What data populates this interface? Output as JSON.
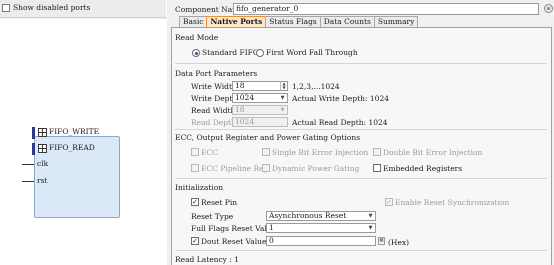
{
  "left": {
    "show_disabled_label": "Show disabled ports",
    "ports": [
      "FIFO_WRITE",
      "FIFO_READ",
      "clk",
      "rst"
    ]
  },
  "header": {
    "component_name_label": "Component Name",
    "component_name_value": "fifo_generator_0"
  },
  "tabs": [
    "Basic",
    "Native Ports",
    "Status Flags",
    "Data Counts",
    "Summary"
  ],
  "read_mode": {
    "title": "Read Mode",
    "opt1": "Standard FIFO",
    "opt2": "First Word Fall Through"
  },
  "data_port": {
    "title": "Data Port Parameters",
    "write_width_label": "Write Width",
    "write_width_value": "18",
    "write_width_range": "1,2,3,...1024",
    "write_depth_label": "Write Depth",
    "write_depth_value": "1024",
    "actual_write_depth": "Actual Write Depth:  1024",
    "read_width_label": "Read Width",
    "read_width_value": "18",
    "read_depth_label": "Read Depth",
    "read_depth_value": "1024",
    "actual_read_depth": "Actual Read Depth:   1024"
  },
  "ecc": {
    "title": "ECC, Output Register and Power Gating Options",
    "ecc_label": "ECC",
    "single_bit": "Single Bit Error Injection",
    "double_bit": "Double Bit Error Injection",
    "pipeline_reg": "ECC Pipeline Reg",
    "dynamic_power": "Dynamic Power Gating",
    "embedded_regs": "Embedded Registers"
  },
  "init": {
    "title": "Initialization",
    "reset_pin": "Reset Pin",
    "enable_reset_sync": "Enable Reset Synchronization",
    "reset_type_label": "Reset Type",
    "reset_type_value": "Asynchronous Reset",
    "full_flags_label": "Full Flags Reset Value",
    "full_flags_value": "1",
    "dout_reset_label": "Dout Reset Value",
    "dout_reset_value": "0",
    "hex_label": "(Hex)"
  },
  "read_latency": "Read Latency : 1"
}
